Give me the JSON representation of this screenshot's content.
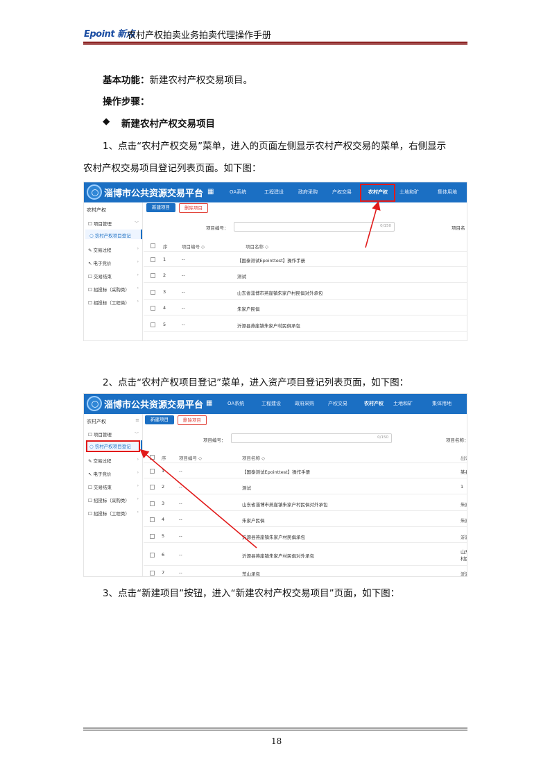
{
  "header": {
    "logo": "Epoint 新点",
    "title": "农村产权拍卖业务拍卖代理操作手册"
  },
  "body": {
    "func_label": "基本功能：",
    "func_text": "新建农村产权交易项目。",
    "steps_label": "操作步骤：",
    "bullet": "◆",
    "section": "新建农村产权交易项目",
    "step1_line1": "1、点击“农村产权交易”菜单，进入的页面左侧显示农村产权交易的菜单，右侧显示",
    "step1_line2": "农村产权交易项目登记列表页面。如下图：",
    "step2": "2、点击“农村产权项目登记”菜单，进入资产项目登记列表页面，如下图：",
    "step3": "3、点击“新建项目”按钮，进入“新建农村产权交易项目”页面，如下图："
  },
  "app": {
    "platform": "淄博市公共资源交易平台",
    "home_icon": "⌂",
    "grid_icon": "▦",
    "nav": [
      "OA系统",
      "工程建设",
      "政府采购",
      "产权交易",
      "农村产权",
      "土地和矿",
      "集体用地"
    ],
    "sidebar": {
      "head": "农村产权",
      "menu_icon": "≡",
      "project_mgmt": "☐ 项目管理",
      "reg_item": "○ 农村产权项目登记",
      "items": [
        "✎ 交易过程",
        "↖ 电子竞价",
        "☐ 交易结束",
        "☐ 招投标（采购类）",
        "☐ 招投标（工程类）"
      ]
    },
    "btn_new": "新建项目",
    "btn_delete": "删除项目",
    "field_label": "项目编号：",
    "field_counter": "0/150",
    "right_label_1": "项目名",
    "right_label_2": "项目名称：",
    "columns": [
      "序",
      "项目编号 ◇",
      "项目名称 ◇"
    ],
    "col_extra": "出让",
    "rows": [
      {
        "no": "1",
        "code": "--",
        "name": "【国泰测试Epointtest】操作手册",
        "extra": "某县"
      },
      {
        "no": "2",
        "code": "--",
        "name": "测试",
        "extra": "1"
      },
      {
        "no": "3",
        "code": "--",
        "name": "山东省淄博市燕崖镇朱家户村民俱对外承包",
        "extra": "朱家"
      },
      {
        "no": "4",
        "code": "--",
        "name": "朱家户民俱",
        "extra": "朱家"
      },
      {
        "no": "5",
        "code": "--",
        "name": "沂源县燕崖镇朱家户村民俱承包",
        "extra": "沂源"
      },
      {
        "no": "6",
        "code": "--",
        "name": "沂源县燕崖镇朱家户村民俱对外承包",
        "extra": "山东"
      },
      {
        "no": "7",
        "code": "--",
        "name": "荒山承包",
        "extra": "沂源"
      }
    ],
    "row6_extra2": "村民"
  },
  "page_number": "18",
  "colors": {
    "accent": "#1b6fc3",
    "highlight": "#e11a1a",
    "header_rule": "#8a1f1f"
  }
}
